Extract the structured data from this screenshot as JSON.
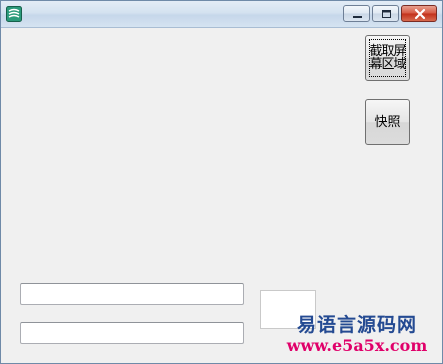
{
  "window": {
    "title": "",
    "icon": "app-logo-icon",
    "controls": [
      "minimize-icon",
      "maximize-icon",
      "close-icon"
    ]
  },
  "buttons": {
    "capture_region": "截取屏幕区域",
    "snapshot": "快照"
  },
  "inputs": {
    "field1_value": "",
    "field2_value": ""
  },
  "watermark": {
    "line1": "易语言源码网",
    "line2": "www.e5a5x.com"
  },
  "colors": {
    "close_button": "#c2311b",
    "watermark_title": "#244a92",
    "watermark_url": "#e0006a"
  }
}
